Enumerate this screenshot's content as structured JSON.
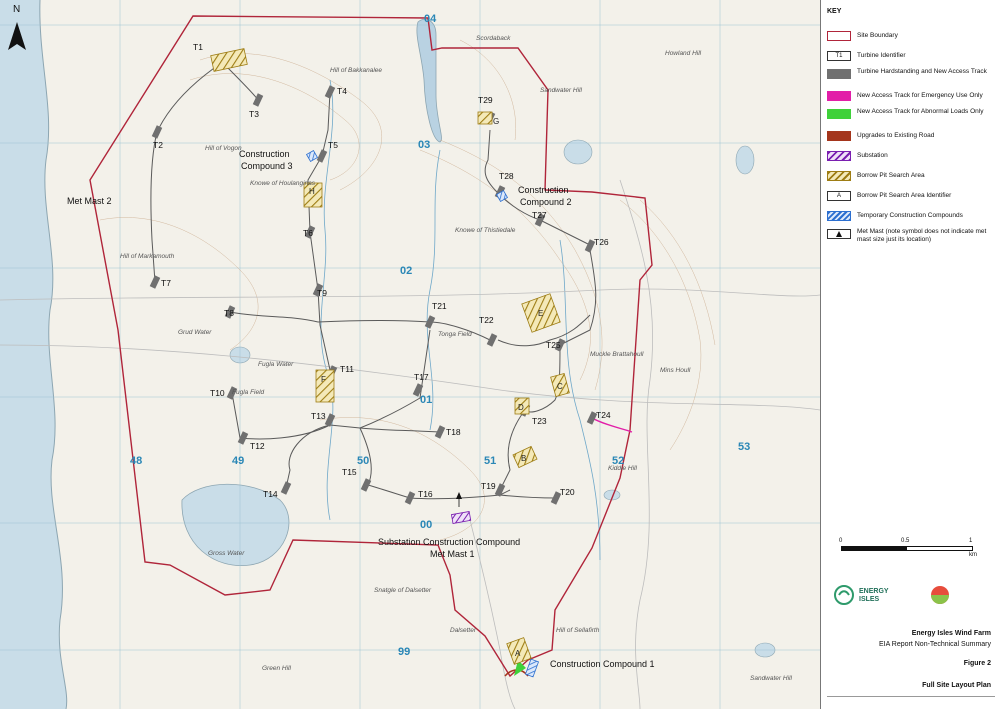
{
  "north_label": "N",
  "key": {
    "title": "KEY",
    "items": [
      {
        "id": "site-boundary",
        "label": "Site Boundary"
      },
      {
        "id": "turbine-identifier",
        "label": "Turbine Identifier",
        "symbol_text": "T1"
      },
      {
        "id": "turbine-hardstanding",
        "label": "Turbine Hardstanding and New Access Track"
      },
      {
        "id": "emergency-track",
        "label": "New Access Track for Emergency Use Only"
      },
      {
        "id": "abnormal-track",
        "label": "New Access Track for Abnormal Loads Only"
      },
      {
        "id": "upgrade-road",
        "label": "Upgrades to Existing Road"
      },
      {
        "id": "substation",
        "label": "Substation"
      },
      {
        "id": "borrow-pit-area",
        "label": "Borrow Pit Search Area"
      },
      {
        "id": "borrow-pit-identifier",
        "label": "Borrow Pit Search Area Identifier",
        "symbol_text": "A"
      },
      {
        "id": "temp-compounds",
        "label": "Temporary Construction Compounds"
      },
      {
        "id": "met-mast",
        "label": "Met Mast (note symbol does not indicate met mast size just its location)"
      }
    ],
    "colors": {
      "boundary": "#b0253a",
      "hardstanding": "#707070",
      "emergency": "#e21ea8",
      "abnormal": "#3fd13a",
      "upgrade": "#a4351c",
      "substation": "#7a1fb0",
      "borrow": "#b08a18",
      "compound": "#2c6fd0"
    }
  },
  "scale": {
    "ticks": [
      "0",
      "0.5",
      "1"
    ],
    "unit": "km"
  },
  "logos": {
    "brand": "ENERGY ISLES"
  },
  "title_block": {
    "project": "Energy Isles Wind Farm",
    "doc": "EIA Report Non-Technical Summary",
    "figure": "Figure 2",
    "plan": "Full Site Layout Plan"
  },
  "map": {
    "turbines": [
      "T1",
      "T2",
      "T3",
      "T4",
      "T5",
      "T6",
      "T7",
      "T8",
      "T9",
      "T10",
      "T11",
      "T12",
      "T13",
      "T14",
      "T15",
      "T16",
      "T17",
      "T18",
      "T19",
      "T20",
      "T21",
      "T22",
      "T23",
      "T24",
      "T25",
      "T26",
      "T27",
      "T28",
      "T29"
    ],
    "borrow_pits": [
      "A",
      "B",
      "C",
      "D",
      "E",
      "F",
      "G",
      "H"
    ],
    "labels": {
      "cc1": "Construction Compound 1",
      "cc2a": "Construction",
      "cc2b": "Compound 2",
      "cc3a": "Construction",
      "cc3b": "Compound 3",
      "substation_cc": "Substation Construction Compound",
      "mm1": "Met Mast 1",
      "mm2": "Met Mast 2"
    },
    "place_names": [
      "Hill of Bakkanalee",
      "Hill of Vogon",
      "Knowe of Houlanginas",
      "Hill of Markamouth",
      "Fugla Water",
      "Fugla Field",
      "Tonga Field",
      "Knowe of Thistiedale",
      "Sandwater Hill",
      "Scordaback",
      "Muckle Brattahoull",
      "Mins Houll",
      "Gross Water",
      "Sandwater Hill",
      "Dalsetter",
      "Hill of Sellafirth",
      "Snatgle of Dalsetter",
      "Green Hill",
      "Kiddie Hill",
      "Howland Hill",
      "Grud Water"
    ],
    "grid_numbers": [
      "04",
      "03",
      "02",
      "01",
      "00",
      "99",
      "48",
      "49",
      "50",
      "51",
      "52",
      "53"
    ]
  }
}
